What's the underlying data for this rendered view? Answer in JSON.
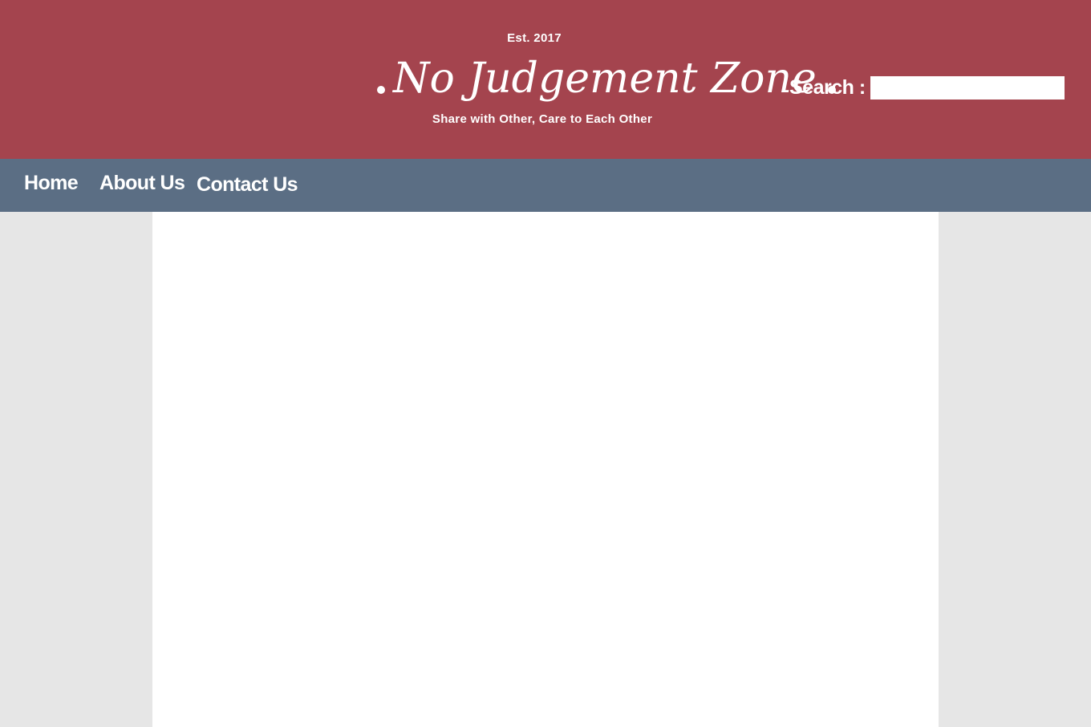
{
  "header": {
    "established": "Est. 2017",
    "site_title": "No Judgement Zone",
    "tagline": "Share with Other, Care to Each Other"
  },
  "search": {
    "label": "Search :",
    "value": "",
    "placeholder": ""
  },
  "nav": {
    "items": [
      {
        "label": "Home"
      },
      {
        "label": "About Us"
      },
      {
        "label": "Contact Us"
      }
    ]
  },
  "colors": {
    "header_bg": "#a4444e",
    "nav_bg": "#5b6e84",
    "page_bg": "#e6e6e6",
    "content_bg": "#ffffff"
  }
}
